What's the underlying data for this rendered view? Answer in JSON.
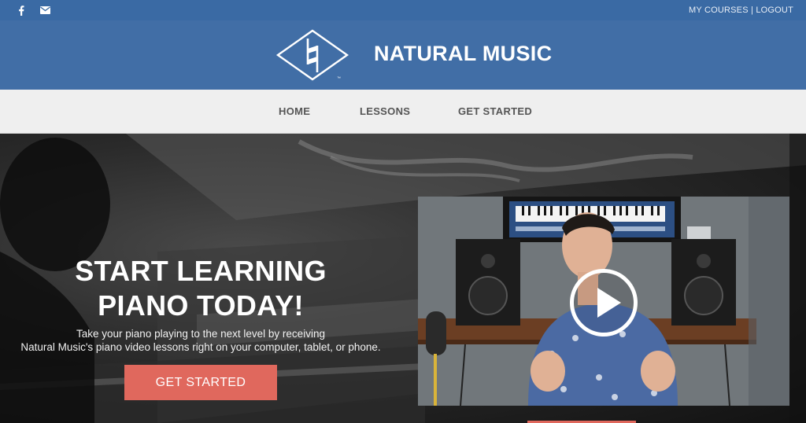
{
  "topbar": {
    "social": [
      {
        "icon": "facebook-icon"
      },
      {
        "icon": "envelope-icon"
      }
    ],
    "account_links": [
      {
        "label": "MY COURSES"
      },
      {
        "label": "LOGOUT"
      }
    ],
    "separator": "|"
  },
  "brand": {
    "title": "NATURAL MUSIC",
    "logo_icon": "natural-sign-diamond-logo",
    "trademark": "™"
  },
  "nav": {
    "items": [
      {
        "label": "HOME"
      },
      {
        "label": "LESSONS"
      },
      {
        "label": "GET STARTED"
      }
    ]
  },
  "hero": {
    "title_line1": "START LEARNING",
    "title_line2": "PIANO TODAY!",
    "subtitle_line1": "Take your piano playing to the next level by receiving",
    "subtitle_line2": "Natural Music's piano video lessons right on your computer, tablet, or phone.",
    "cta_label": "GET STARTED",
    "video_icon": "play-icon"
  },
  "colors": {
    "topbar": "#3a6aa4",
    "brand": "#416ea6",
    "nav_bg": "#efefef",
    "cta": "#e0685d"
  }
}
